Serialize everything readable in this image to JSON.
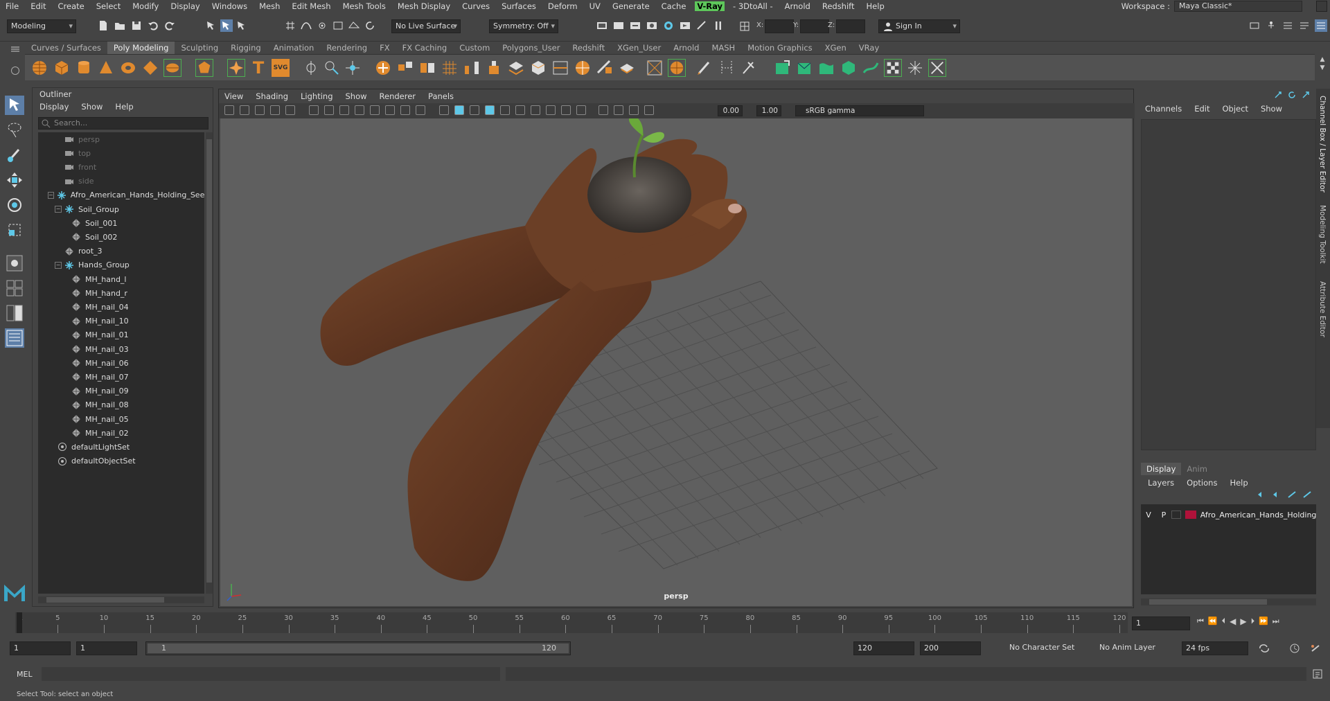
{
  "menubar": {
    "items": [
      "File",
      "Edit",
      "Create",
      "Select",
      "Modify",
      "Display",
      "Windows",
      "Mesh",
      "Edit Mesh",
      "Mesh Tools",
      "Mesh Display",
      "Curves",
      "Surfaces",
      "Deform",
      "UV",
      "Generate",
      "Cache",
      "V-Ray",
      "- 3DtoAll -",
      "Arnold",
      "Redshift",
      "Help"
    ],
    "workspace_label": "Workspace :",
    "workspace_value": "Maya Classic*"
  },
  "statusline": {
    "mode": "Modeling",
    "live_surface": "No Live Surface",
    "symmetry": "Symmetry: Off",
    "x_label": "X:",
    "y_label": "Y:",
    "z_label": "Z:",
    "sign_in": "Sign In"
  },
  "shelf": {
    "tabs": [
      "Curves / Surfaces",
      "Poly Modeling",
      "Sculpting",
      "Rigging",
      "Animation",
      "Rendering",
      "FX",
      "FX Caching",
      "Custom",
      "Polygons_User",
      "Redshift",
      "XGen_User",
      "Arnold",
      "MASH",
      "Motion Graphics",
      "XGen",
      "VRay"
    ],
    "active_tab": "Poly Modeling",
    "text_icon": "T",
    "svg_icon": "SVG"
  },
  "outliner": {
    "title": "Outliner",
    "menu": [
      "Display",
      "Show",
      "Help"
    ],
    "search_placeholder": "Search...",
    "rows": [
      {
        "label": "persp",
        "indent": 1,
        "icon": "camera-icon",
        "dim": true
      },
      {
        "label": "top",
        "indent": 1,
        "icon": "camera-icon",
        "dim": true
      },
      {
        "label": "front",
        "indent": 1,
        "icon": "camera-icon",
        "dim": true
      },
      {
        "label": "side",
        "indent": 1,
        "icon": "camera-icon",
        "dim": true
      },
      {
        "label": "Afro_American_Hands_Holding_Seed",
        "indent": 0,
        "icon": "group-icon",
        "expander": "−"
      },
      {
        "label": "Soil_Group",
        "indent": 1,
        "icon": "group-icon",
        "expander": "−"
      },
      {
        "label": "Soil_001",
        "indent": 2,
        "icon": "mesh-icon"
      },
      {
        "label": "Soil_002",
        "indent": 2,
        "icon": "mesh-icon"
      },
      {
        "label": "root_3",
        "indent": 1,
        "icon": "mesh-icon"
      },
      {
        "label": "Hands_Group",
        "indent": 1,
        "icon": "group-icon",
        "expander": "−"
      },
      {
        "label": "MH_hand_l",
        "indent": 2,
        "icon": "mesh-icon"
      },
      {
        "label": "MH_hand_r",
        "indent": 2,
        "icon": "mesh-icon"
      },
      {
        "label": "MH_nail_04",
        "indent": 2,
        "icon": "mesh-icon"
      },
      {
        "label": "MH_nail_10",
        "indent": 2,
        "icon": "mesh-icon"
      },
      {
        "label": "MH_nail_01",
        "indent": 2,
        "icon": "mesh-icon"
      },
      {
        "label": "MH_nail_03",
        "indent": 2,
        "icon": "mesh-icon"
      },
      {
        "label": "MH_nail_06",
        "indent": 2,
        "icon": "mesh-icon"
      },
      {
        "label": "MH_nail_07",
        "indent": 2,
        "icon": "mesh-icon"
      },
      {
        "label": "MH_nail_09",
        "indent": 2,
        "icon": "mesh-icon"
      },
      {
        "label": "MH_nail_08",
        "indent": 2,
        "icon": "mesh-icon"
      },
      {
        "label": "MH_nail_05",
        "indent": 2,
        "icon": "mesh-icon"
      },
      {
        "label": "MH_nail_02",
        "indent": 2,
        "icon": "mesh-icon"
      },
      {
        "label": "defaultLightSet",
        "indent": 0,
        "icon": "set-icon"
      },
      {
        "label": "defaultObjectSet",
        "indent": 0,
        "icon": "set-icon"
      }
    ]
  },
  "viewport": {
    "menu": [
      "View",
      "Shading",
      "Lighting",
      "Show",
      "Renderer",
      "Panels"
    ],
    "exposure": "0.00",
    "gamma": "1.00",
    "color_space": "sRGB gamma",
    "camera_label": "persp"
  },
  "channel_box": {
    "menu": [
      "Channels",
      "Edit",
      "Object",
      "Show"
    ],
    "vertical_tabs": [
      "Channel Box / Layer Editor",
      "Modeling Toolkit",
      "Attribute Editor"
    ]
  },
  "layer_editor": {
    "tabs": [
      "Display",
      "Anim"
    ],
    "active_tab": "Display",
    "menu": [
      "Layers",
      "Options",
      "Help"
    ],
    "layer": {
      "v": "V",
      "p": "P",
      "name": "Afro_American_Hands_Holding",
      "color": "#b0123a"
    }
  },
  "timeline": {
    "ticks": [
      "1",
      "5",
      "10",
      "15",
      "20",
      "25",
      "30",
      "35",
      "40",
      "45",
      "50",
      "55",
      "60",
      "65",
      "70",
      "75",
      "80",
      "85",
      "90",
      "95",
      "100",
      "105",
      "110",
      "115",
      "120"
    ],
    "current_frame": "1"
  },
  "range": {
    "start": "1",
    "playback_start": "1",
    "slider_start": "1",
    "slider_end": "120",
    "playback_end": "120",
    "end": "200",
    "character_set": "No Character Set",
    "anim_layer": "No Anim Layer",
    "fps": "24 fps"
  },
  "command": {
    "label": "MEL",
    "help": "Select Tool: select an object"
  }
}
